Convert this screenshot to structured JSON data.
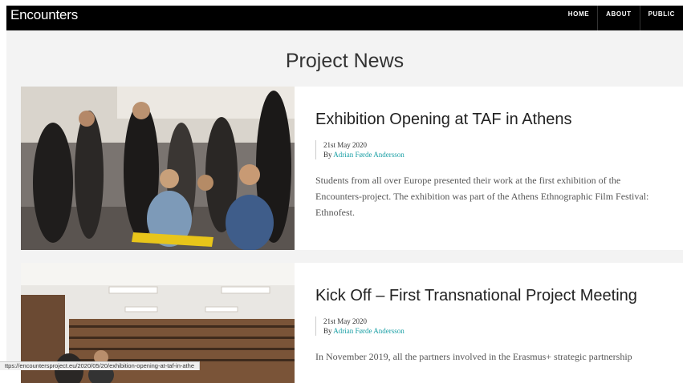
{
  "header": {
    "brand": "Encounters",
    "nav": [
      "HOME",
      "ABOUT",
      "PUBLIC"
    ]
  },
  "main": {
    "title": "Project News",
    "posts": [
      {
        "title": "Exhibition Opening at TAF in Athens",
        "date": "21st May 2020",
        "by": "By",
        "author": "Adrian Førde Andersson",
        "excerpt": "Students from all over Europe presented their work at the first exhibition of the Encounters-project. The exhibition was part of the Athens Ethnographic Film Festival: Ethnofest."
      },
      {
        "title": "Kick Off – First Transnational Project Meeting",
        "date": "21st May 2020",
        "by": "By",
        "author": "Adrian Førde Andersson",
        "excerpt": "In November 2019, all the partners involved in the Erasmus+ strategic partnership"
      }
    ]
  },
  "status_bar": {
    "url": "ttps://encountersproject.eu/2020/05/20/exhibition-opening-at-taf-in-athe"
  },
  "colors": {
    "topbar": "#000000",
    "background": "#f3f3f3",
    "author_link": "#1a9fa5"
  }
}
